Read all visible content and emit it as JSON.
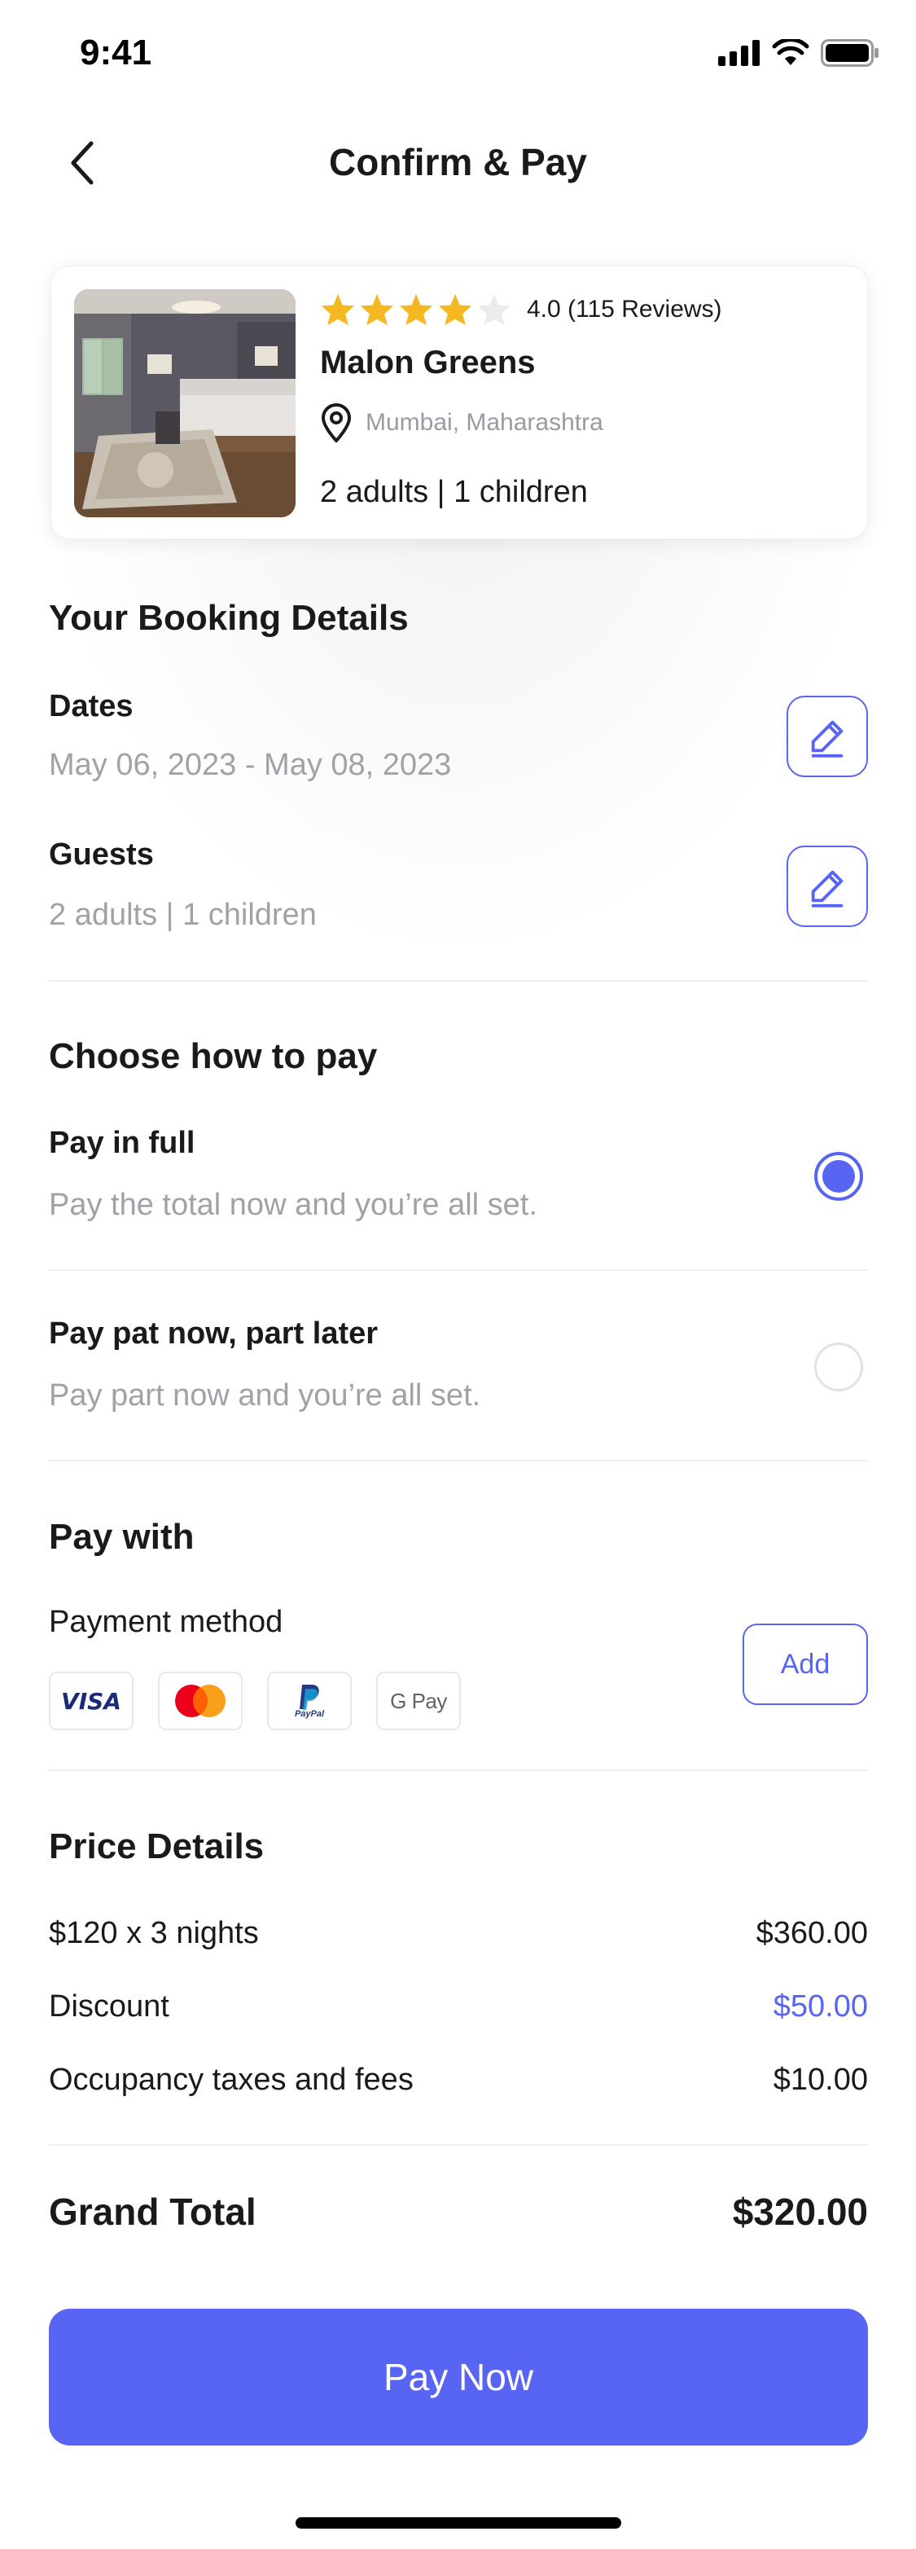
{
  "status_bar": {
    "time": "9:41"
  },
  "nav": {
    "title": "Confirm & Pay",
    "back_icon": "chevron-left-icon"
  },
  "hotel": {
    "rating_value": 4,
    "rating_max": 5,
    "rating_text": "4.0 (115 Reviews)",
    "name": "Malon Greens",
    "location": "Mumbai, Maharashtra",
    "guests": "2 adults | 1 children"
  },
  "booking": {
    "title": "Your Booking Details",
    "dates_label": "Dates",
    "dates_value": "May 06, 2023 - May 08, 2023",
    "guests_label": "Guests",
    "guests_value": "2 adults | 1 children"
  },
  "pay_option": {
    "title": "Choose how to pay",
    "options": [
      {
        "label": "Pay in full",
        "desc": "Pay the total now and you’re all set.",
        "selected": true
      },
      {
        "label": "Pay pat now, part later",
        "desc": "Pay part now and you’re all set.",
        "selected": false
      }
    ]
  },
  "pay_with": {
    "title": "Pay with",
    "method_label": "Payment method",
    "methods": [
      "VISA",
      "Mastercard",
      "PayPal",
      "G Pay"
    ],
    "add_label": "Add"
  },
  "price": {
    "title": "Price Details",
    "rows": [
      {
        "label": "$120 x 3 nights",
        "value": "$360.00"
      },
      {
        "label": "Discount",
        "value": "$50.00"
      },
      {
        "label": "Occupancy taxes and fees",
        "value": "$10.00"
      }
    ],
    "grand_label": "Grand Total",
    "grand_value": "$320.00"
  },
  "cta": {
    "label": "Pay Now"
  },
  "colors": {
    "accent": "#5865f2",
    "star": "#f5b820",
    "muted": "#a1a1a8"
  }
}
